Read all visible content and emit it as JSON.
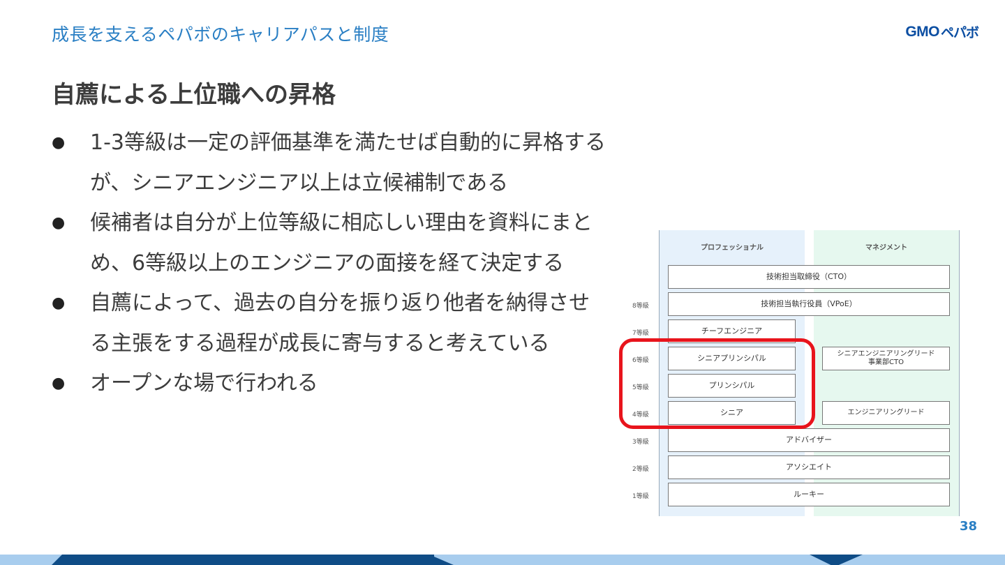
{
  "header": {
    "title": "成長を支えるペパボのキャリアパスと制度",
    "logo_gmo": "GMO",
    "logo_pepabo": "ペパボ"
  },
  "slide": {
    "heading": "自薦による上位職への昇格",
    "bullets": [
      "1-3等級は一定の評価基準を満たせば自動的に昇格するが、シニアエンジニア以上は立候補制である",
      "候補者は自分が上位等級に相応しい理由を資料にまとめ、6等級以上のエンジニアの面接を経て決定する",
      "自薦によって、過去の自分を振り返り他者を納得させる主張をする過程が成長に寄与すると考えている",
      "オープンな場で行われる"
    ],
    "bullet_glyph": "●",
    "page_number": "38"
  },
  "diagram": {
    "columns": {
      "professional": "プロフェッショナル",
      "management": "マネジメント"
    },
    "grades": {
      "g8": "8等級",
      "g7": "7等級",
      "g6": "6等級",
      "g5": "5等級",
      "g4": "4等級",
      "g3": "3等級",
      "g2": "2等級",
      "g1": "1等級"
    },
    "boxes": {
      "cto": "技術担当取締役（CTO）",
      "vpoe": "技術担当執行役員（VPoE）",
      "chief": "チーフエンジニア",
      "senior_principal": "シニアプリンシパル",
      "senior_lead": "シニアエンジニアリングリード",
      "senior_lead_sub": "事業部CTO",
      "principal": "プリンシパル",
      "senior": "シニア",
      "lead": "エンジニアリングリード",
      "advisor": "アドバイザー",
      "associate": "アソシエイト",
      "rookie": "ルーキー"
    },
    "highlight_color": "#e8141c"
  }
}
